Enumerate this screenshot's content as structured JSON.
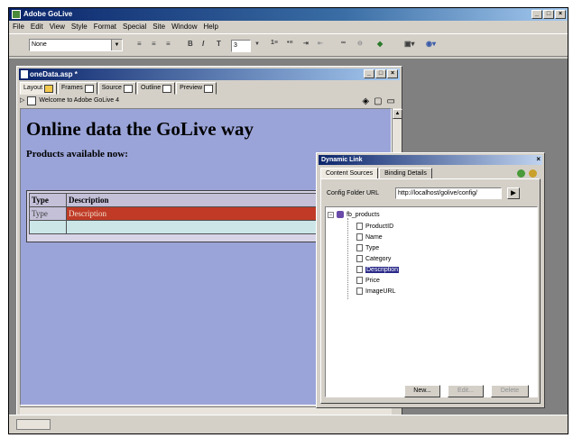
{
  "app": {
    "title": "Adobe GoLive"
  },
  "menu": [
    "File",
    "Edit",
    "View",
    "Style",
    "Format",
    "Special",
    "Site",
    "Window",
    "Help"
  ],
  "toolbar": {
    "format_select": "None",
    "size_value": "3"
  },
  "document": {
    "title": "oneData.asp *",
    "tabs": [
      "Layout",
      "Frames",
      "Source",
      "Outline",
      "Preview"
    ],
    "path": "Welcome to Adobe GoLive 4",
    "heading": "Online data the GoLive way",
    "subheading": "Products available now:",
    "table": {
      "columns": [
        "Type",
        "Description"
      ],
      "rows": [
        [
          "Type",
          "Description"
        ],
        [
          "",
          ""
        ]
      ]
    }
  },
  "palette": {
    "title": "Dynamic Link",
    "tabs": [
      "Content Sources",
      "Binding Details"
    ],
    "config_label": "Config Folder URL",
    "config_value": "http://localhost/golive/config/",
    "tree": {
      "root": "fb_products",
      "fields": [
        "ProductID",
        "Name",
        "Type",
        "Category",
        "Description",
        "Price",
        "ImageURL"
      ],
      "selected": "Description"
    },
    "buttons": [
      "New...",
      "Edit...",
      "Delete"
    ]
  }
}
